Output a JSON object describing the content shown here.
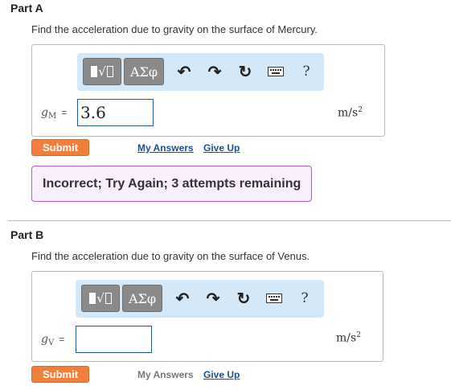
{
  "partA": {
    "heading": "Part A",
    "question": "Find the acceleration due to gravity on the surface of Mercury.",
    "var_main": "g",
    "var_sub": "M",
    "equals": "=",
    "input_value": "3.6",
    "unit_base": "m/s",
    "unit_exp": "2",
    "submit_label": "Submit",
    "my_answers_label": "My Answers",
    "give_up_label": "Give Up",
    "feedback": "Incorrect; Try Again; 3 attempts remaining"
  },
  "partB": {
    "heading": "Part B",
    "question": "Find the acceleration due to gravity on the surface of Venus.",
    "var_main": "g",
    "var_sub": "V",
    "equals": "=",
    "input_value": "",
    "unit_base": "m/s",
    "unit_exp": "2",
    "submit_label": "Submit",
    "my_answers_label": "My Answers",
    "give_up_label": "Give Up"
  },
  "toolbar": {
    "greek_label": "ΑΣφ",
    "help_label": "?",
    "icons": [
      "templates-icon",
      "greek-symbols-icon",
      "undo-icon",
      "redo-icon",
      "reset-icon",
      "keyboard-icon",
      "help-icon"
    ]
  },
  "colors": {
    "submit": "#f07f3c",
    "link": "#1e4f91",
    "toolbar_bg": "#d5e8f8",
    "feedback_border": "#b35cc4",
    "input_border": "#1e5aa8"
  }
}
